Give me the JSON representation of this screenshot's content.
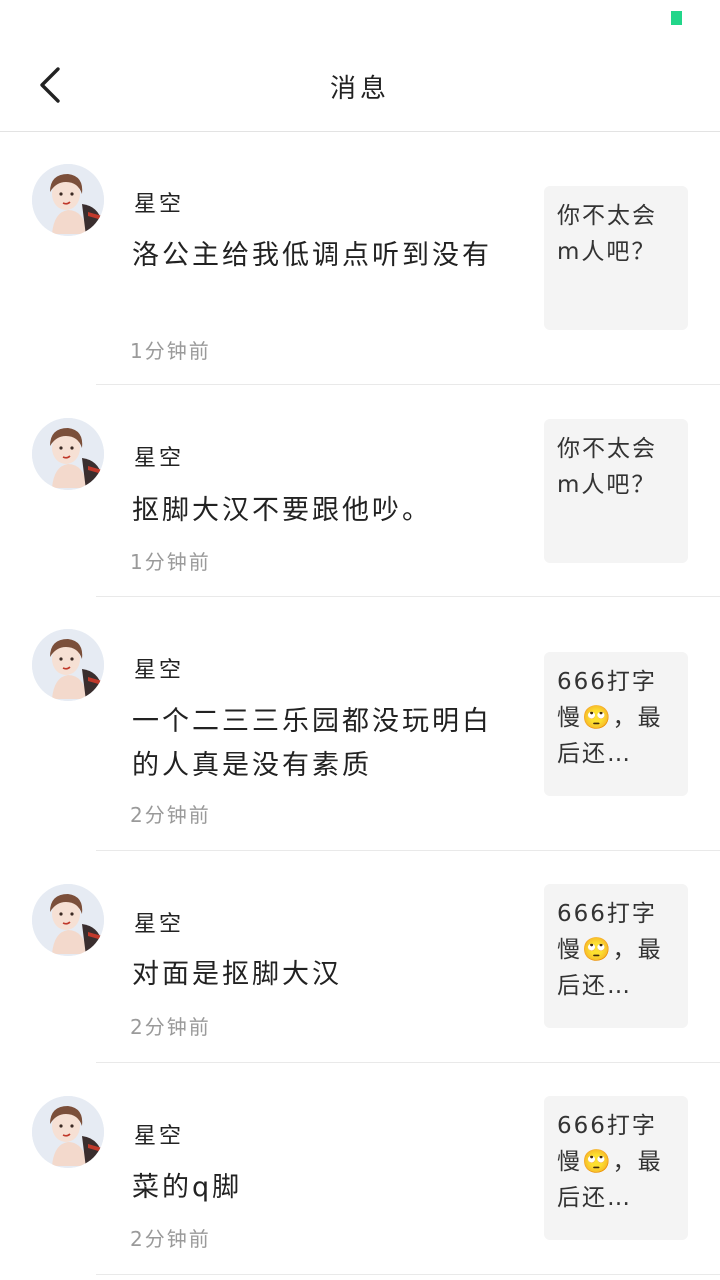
{
  "header": {
    "title": "消息"
  },
  "messages": [
    {
      "user": "星空",
      "text": "洛公主给我低调点听到没有",
      "time": "1分钟前",
      "quote": "你不太会m人吧？"
    },
    {
      "user": "星空",
      "text": "抠脚大汉不要跟他吵。",
      "time": "1分钟前",
      "quote": "你不太会m人吧？"
    },
    {
      "user": "星空",
      "text": "一个二三三乐园都没玩明白的人真是没有素质",
      "time": "2分钟前",
      "quote": "666打字慢🙄，最后还…"
    },
    {
      "user": "星空",
      "text": "对面是抠脚大汉",
      "time": "2分钟前",
      "quote": "666打字慢🙄，最后还…"
    },
    {
      "user": "星空",
      "text": "菜的q脚",
      "time": "2分钟前",
      "quote": "666打字慢🙄，最后还…"
    }
  ],
  "icons": {
    "back": "chevron-left-icon",
    "status": "status-indicator"
  },
  "colors": {
    "status_indicator": "#22d68a",
    "divider": "#e3e3e3",
    "quote_bg": "#f4f4f4",
    "time_text": "#9a9a9a"
  }
}
